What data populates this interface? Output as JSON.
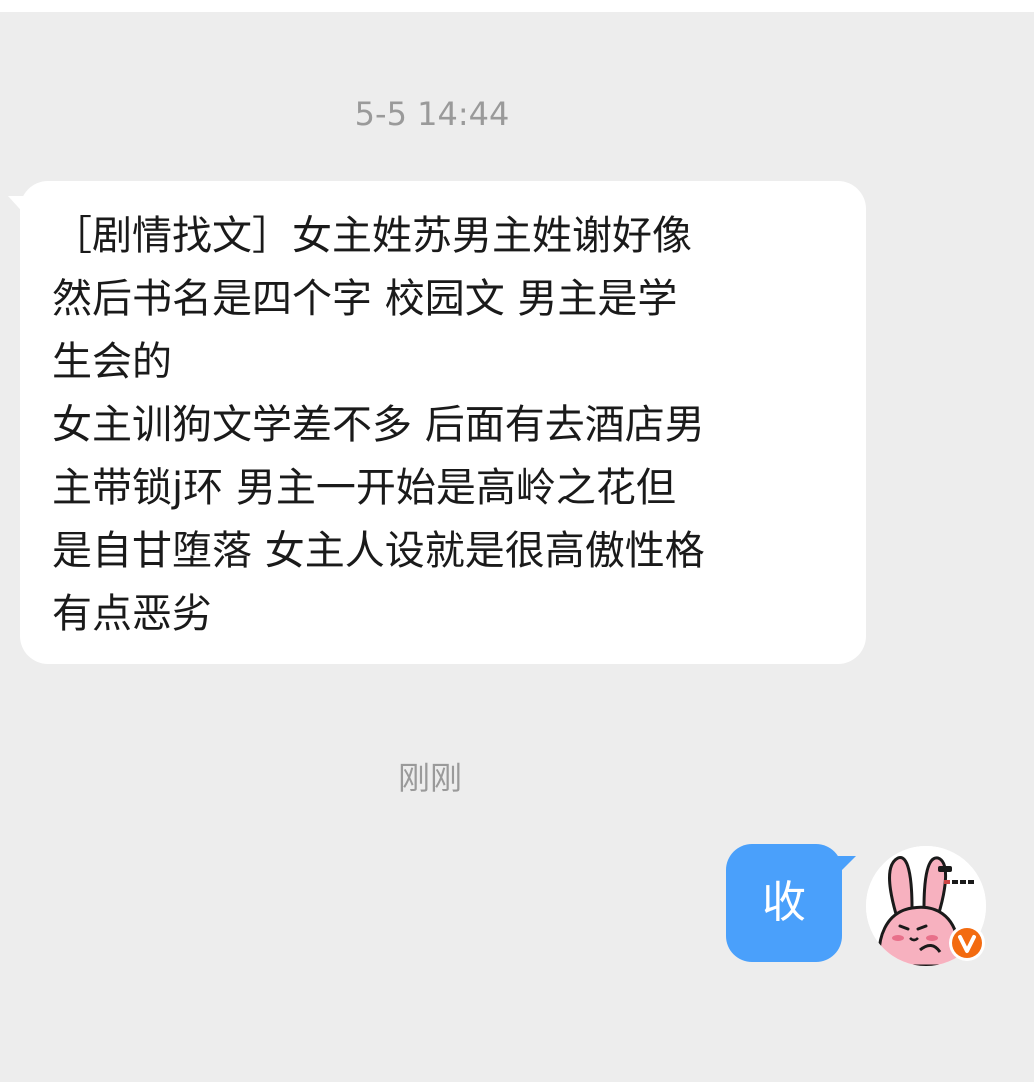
{
  "timestamps": {
    "first": "5-5 14:44",
    "second": "刚刚"
  },
  "incoming_message": {
    "text": "［剧情找文］女主姓苏男主姓谢好像\n然后书名是四个字  校园文  男主是学\n生会的\n女主训狗文学差不多 后面有去酒店男\n主带锁j环 男主一开始是高岭之花但\n是自甘堕落 女主人设就是很高傲性格\n有点恶劣"
  },
  "outgoing_message": {
    "text": "收"
  },
  "avatar": {
    "icon": "pink-rabbit-sticker-icon",
    "badge": "v",
    "badge_icon": "verified-v-badge-icon",
    "badge_color": "#f36b10"
  },
  "colors": {
    "background": "#ededed",
    "incoming_bubble": "#ffffff",
    "outgoing_bubble": "#4aa0fb",
    "timestamp_text": "#9a9a9a"
  }
}
